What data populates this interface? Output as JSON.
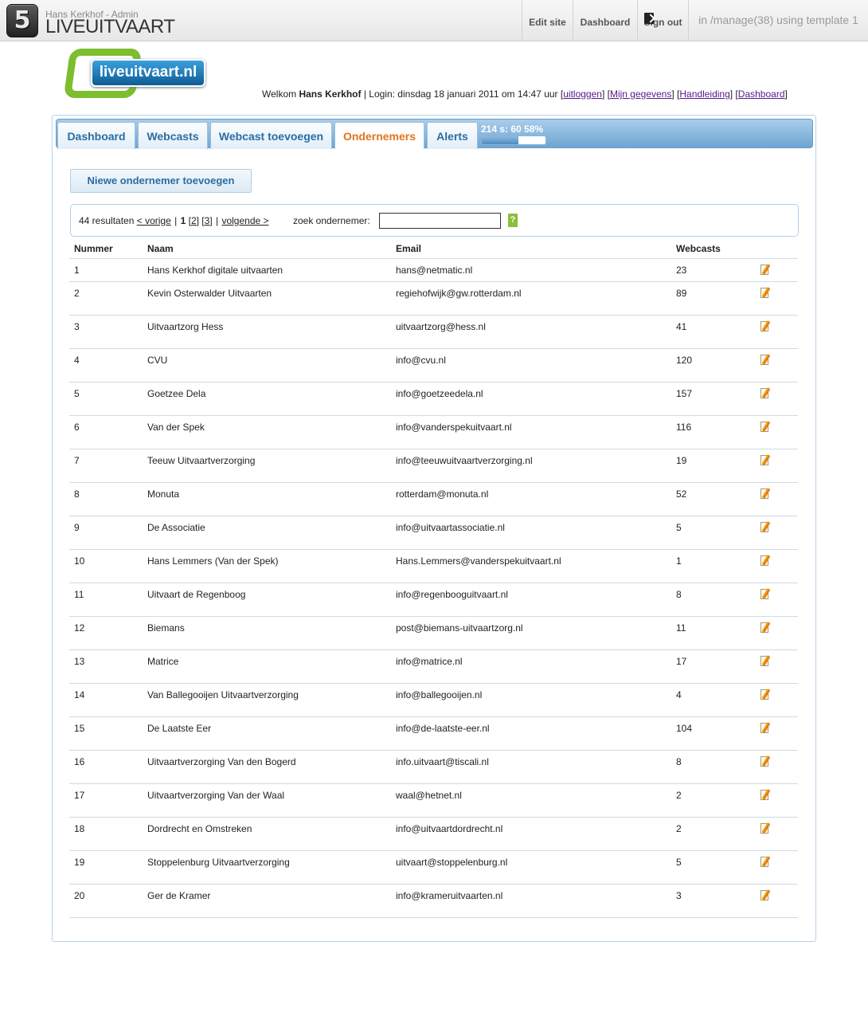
{
  "cms": {
    "logo_glyph": "5",
    "user": "Hans Kerkhof - Admin",
    "site_name": "LIVEUITVAART",
    "edit_site": "Edit site",
    "dashboard": "Dashboard",
    "sign_out": "Sign out",
    "info": "in /manage(38) using template 1"
  },
  "logo": {
    "text": "liveuitvaart.nl"
  },
  "welcome": {
    "prefix": "Welkom ",
    "name": "Hans Kerkhof",
    "login": " | Login: dinsdag 18 januari 2011 om 14:47 uur ",
    "links": [
      "uitloggen",
      "Mijn gegevens",
      "Handleiding",
      "Dashboard"
    ]
  },
  "tabs": [
    {
      "label": "Dashboard",
      "active": false
    },
    {
      "label": "Webcasts",
      "active": false
    },
    {
      "label": "Webcast toevoegen",
      "active": false
    },
    {
      "label": "Ondernemers",
      "active": true
    },
    {
      "label": "Alerts",
      "active": false
    }
  ],
  "quota": {
    "text": "214 s: 60 58%",
    "percent": 58
  },
  "new_button": "Niewe ondernemer toevoegen",
  "pager": {
    "results": "44 resultaten",
    "prev": "< vorige",
    "current": "1",
    "pages": [
      "2",
      "3"
    ],
    "next": "volgende >"
  },
  "search": {
    "label": "zoek ondernemer:",
    "value": "",
    "go": "?"
  },
  "colors": {
    "accent": "#e0751b",
    "tab_text": "#2b6da3",
    "go_button": "#89bf3a"
  },
  "table": {
    "headers": [
      "Nummer",
      "Naam",
      "Email",
      "Webcasts"
    ],
    "rows": [
      {
        "num": "1",
        "name": "Hans Kerkhof digitale uitvaarten",
        "email": "hans@netmatic.nl",
        "webcasts": "23"
      },
      {
        "num": "2",
        "name": "Kevin Osterwalder Uitvaarten",
        "email": "regiehofwijk@gw.rotterdam.nl",
        "webcasts": "89"
      },
      {
        "num": "3",
        "name": "Uitvaartzorg Hess",
        "email": "uitvaartzorg@hess.nl",
        "webcasts": "41"
      },
      {
        "num": "4",
        "name": "CVU",
        "email": "info@cvu.nl",
        "webcasts": "120"
      },
      {
        "num": "5",
        "name": "Goetzee Dela",
        "email": "info@goetzeedela.nl",
        "webcasts": "157"
      },
      {
        "num": "6",
        "name": "Van der Spek",
        "email": "info@vanderspekuitvaart.nl",
        "webcasts": "116"
      },
      {
        "num": "7",
        "name": "Teeuw Uitvaartverzorging",
        "email": "info@teeuwuitvaartverzorging.nl",
        "webcasts": "19"
      },
      {
        "num": "8",
        "name": "Monuta",
        "email": "rotterdam@monuta.nl",
        "webcasts": "52"
      },
      {
        "num": "9",
        "name": "De Associatie",
        "email": "info@uitvaartassociatie.nl",
        "webcasts": "5"
      },
      {
        "num": "10",
        "name": "Hans Lemmers (Van der Spek)",
        "email": "Hans.Lemmers@vanderspekuitvaart.nl",
        "webcasts": "1"
      },
      {
        "num": "11",
        "name": "Uitvaart de Regenboog",
        "email": "info@regenbooguitvaart.nl",
        "webcasts": "8"
      },
      {
        "num": "12",
        "name": "Biemans",
        "email": "post@biemans-uitvaartzorg.nl",
        "webcasts": "11"
      },
      {
        "num": "13",
        "name": "Matrice",
        "email": "info@matrice.nl",
        "webcasts": "17"
      },
      {
        "num": "14",
        "name": "Van Ballegooijen Uitvaartverzorging",
        "email": "info@ballegooijen.nl",
        "webcasts": "4"
      },
      {
        "num": "15",
        "name": "De Laatste Eer",
        "email": "info@de-laatste-eer.nl",
        "webcasts": "104"
      },
      {
        "num": "16",
        "name": "Uitvaartverzorging Van den Bogerd",
        "email": "info.uitvaart@tiscali.nl",
        "webcasts": "8"
      },
      {
        "num": "17",
        "name": "Uitvaartverzorging Van der Waal",
        "email": "waal@hetnet.nl",
        "webcasts": "2"
      },
      {
        "num": "18",
        "name": "Dordrecht en Omstreken",
        "email": "info@uitvaartdordrecht.nl",
        "webcasts": "2"
      },
      {
        "num": "19",
        "name": "Stoppelenburg Uitvaartverzorging",
        "email": "uitvaart@stoppelenburg.nl",
        "webcasts": "5"
      },
      {
        "num": "20",
        "name": "Ger de Kramer",
        "email": "info@krameruitvaarten.nl",
        "webcasts": "3"
      }
    ]
  }
}
